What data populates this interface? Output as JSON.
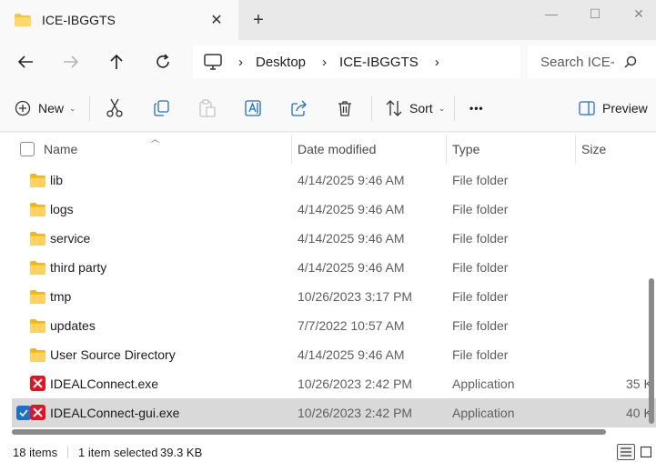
{
  "window": {
    "tab_title": "ICE-IBGGTS",
    "close_tab_glyph": "✕",
    "new_tab_glyph": "+",
    "minimize_glyph": "—",
    "maximize_glyph": "☐"
  },
  "address": {
    "crumbs": [
      "Desktop",
      "ICE-IBGGTS"
    ],
    "sep": "›",
    "search_placeholder": "Search ICE-"
  },
  "toolbar": {
    "new_label": "New",
    "sort_label": "Sort",
    "more_label": "•••",
    "preview_label": "Preview",
    "chevron": "⌄"
  },
  "columns": {
    "name": "Name",
    "date": "Date modified",
    "type": "Type",
    "size": "Size"
  },
  "files": [
    {
      "name": "lib",
      "date": "4/14/2025 9:46 AM",
      "type": "File folder",
      "size": "",
      "kind": "folder"
    },
    {
      "name": "logs",
      "date": "4/14/2025 9:46 AM",
      "type": "File folder",
      "size": "",
      "kind": "folder"
    },
    {
      "name": "service",
      "date": "4/14/2025 9:46 AM",
      "type": "File folder",
      "size": "",
      "kind": "folder"
    },
    {
      "name": "third party",
      "date": "4/14/2025 9:46 AM",
      "type": "File folder",
      "size": "",
      "kind": "folder"
    },
    {
      "name": "tmp",
      "date": "10/26/2023 3:17 PM",
      "type": "File folder",
      "size": "",
      "kind": "folder"
    },
    {
      "name": "updates",
      "date": "7/7/2022 10:57 AM",
      "type": "File folder",
      "size": "",
      "kind": "folder"
    },
    {
      "name": "User Source Directory",
      "date": "4/14/2025 9:46 AM",
      "type": "File folder",
      "size": "",
      "kind": "folder"
    },
    {
      "name": "IDEALConnect.exe",
      "date": "10/26/2023 2:42 PM",
      "type": "Application",
      "size": "35 K",
      "kind": "exe"
    },
    {
      "name": "IDEALConnect-gui.exe",
      "date": "10/26/2023 2:42 PM",
      "type": "Application",
      "size": "40 K",
      "kind": "exe",
      "selected": true
    }
  ],
  "status": {
    "items": "18 items",
    "selected": "1 item selected",
    "size": "39.3 KB"
  },
  "colors": {
    "folder": "#f4c542",
    "exe_red": "#e81123",
    "accent": "#1f6fc5"
  }
}
